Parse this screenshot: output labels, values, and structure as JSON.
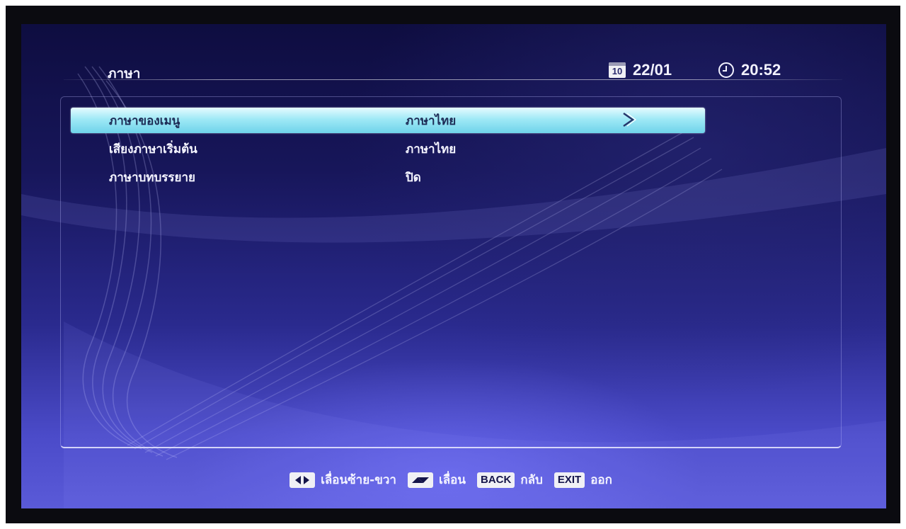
{
  "header": {
    "title": "ภาษา",
    "date": "22/01",
    "calendar_day": "10",
    "time": "20:52"
  },
  "menu": {
    "items": [
      {
        "label": "ภาษาของเมนู",
        "value": "ภาษาไทย",
        "selected": true
      },
      {
        "label": "เสียงภาษาเริ่มต้น",
        "value": "ภาษาไทย",
        "selected": false
      },
      {
        "label": "ภาษาบทบรรยาย",
        "value": "ปิด",
        "selected": false
      }
    ]
  },
  "footer": {
    "left_right_label": "เลื่อนซ้าย-ขวา",
    "up_down_label": "เลื่อน",
    "back_key": "BACK",
    "back_label": "กลับ",
    "exit_key": "EXIT",
    "exit_label": "ออก"
  },
  "colors": {
    "background_top": "#0e0d40",
    "background_bottom": "#5a5ad8",
    "highlight": "#9fe9f6",
    "text": "#f4f4ff"
  },
  "icons": [
    "calendar-icon",
    "clock-icon",
    "arrow-right-icon",
    "left-right-key-icon",
    "up-down-key-icon"
  ]
}
